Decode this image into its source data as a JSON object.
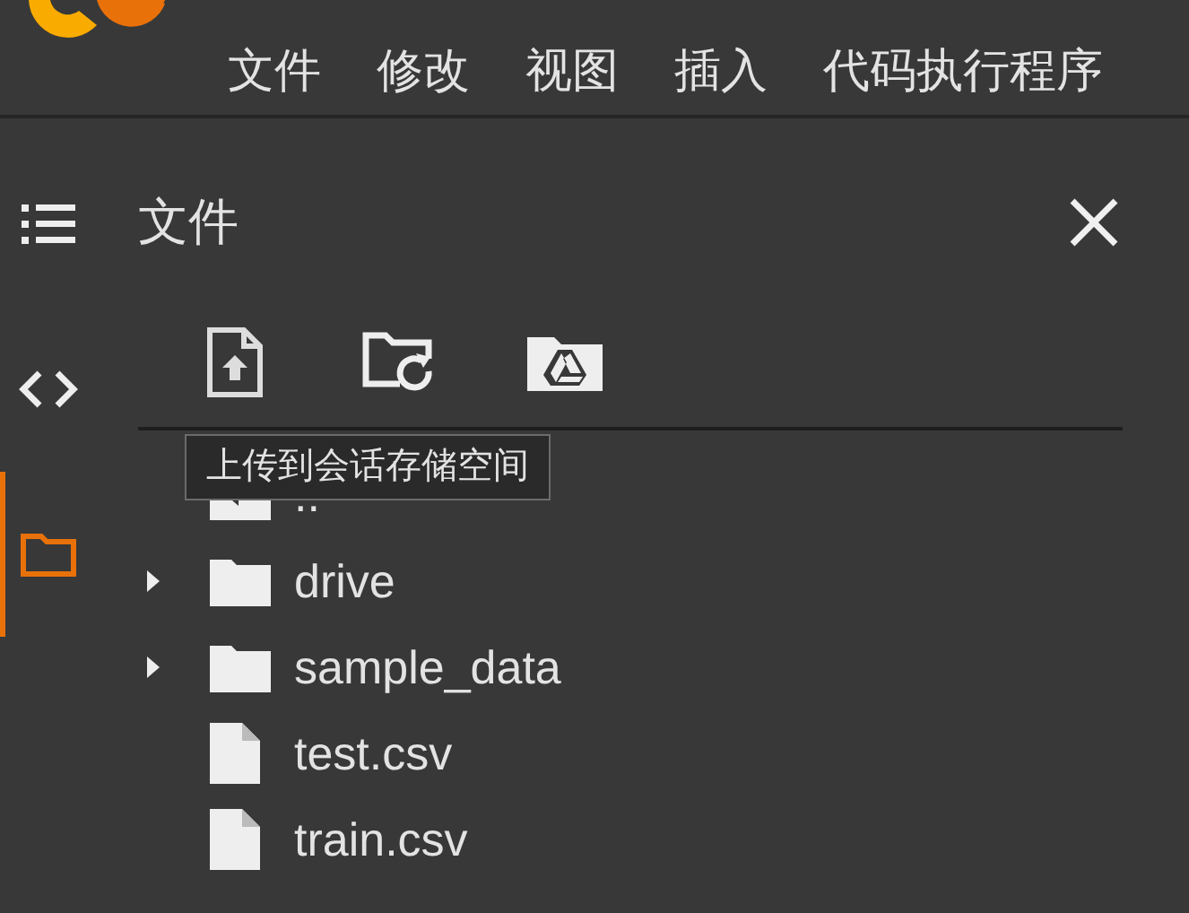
{
  "menu": [
    {
      "label": "文件"
    },
    {
      "label": "修改"
    },
    {
      "label": "视图"
    },
    {
      "label": "插入"
    },
    {
      "label": "代码执行程序"
    }
  ],
  "rail": [
    {
      "kind": "toc",
      "selected": false
    },
    {
      "kind": "code",
      "selected": false
    },
    {
      "kind": "files",
      "selected": true
    }
  ],
  "panel": {
    "title": "文件",
    "toolbar": [
      {
        "kind": "upload"
      },
      {
        "kind": "refresh"
      },
      {
        "kind": "drive"
      }
    ],
    "tooltip": "上传到会话存储空间",
    "tree": [
      {
        "kind": "parent",
        "name": ".."
      },
      {
        "kind": "folder",
        "name": "drive",
        "expanded": false
      },
      {
        "kind": "folder",
        "name": "sample_data",
        "expanded": false
      },
      {
        "kind": "file",
        "name": "test.csv"
      },
      {
        "kind": "file",
        "name": "train.csv"
      }
    ]
  }
}
